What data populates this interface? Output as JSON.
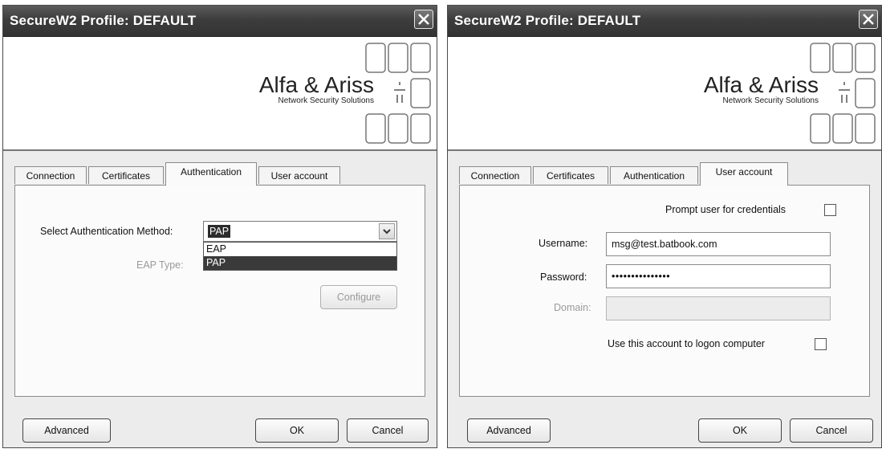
{
  "left_dialog": {
    "title": "SecureW2 Profile: DEFAULT",
    "logo": {
      "company": "Alfa & Ariss",
      "tagline": "Network Security Solutions"
    },
    "tabs": [
      {
        "label": "Connection"
      },
      {
        "label": "Certificates"
      },
      {
        "label": "Authentication"
      },
      {
        "label": "User account"
      }
    ],
    "active_tab": "Authentication",
    "auth_method_label": "Select Authentication Method:",
    "auth_method_value": "PAP",
    "auth_method_options": [
      "EAP",
      "PAP"
    ],
    "highlighted_option": "PAP",
    "eap_type_label": "EAP Type:",
    "configure_label": "Configure",
    "advanced_label": "Advanced",
    "ok_label": "OK",
    "cancel_label": "Cancel"
  },
  "right_dialog": {
    "title": "SecureW2 Profile: DEFAULT",
    "logo": {
      "company": "Alfa & Ariss",
      "tagline": "Network Security Solutions"
    },
    "tabs": [
      {
        "label": "Connection"
      },
      {
        "label": "Certificates"
      },
      {
        "label": "Authentication"
      },
      {
        "label": "User account"
      }
    ],
    "active_tab": "User account",
    "prompt_label": "Prompt user for credentials",
    "prompt_checked": false,
    "username_label": "Username:",
    "username_value": "msg@test.batbook.com",
    "password_label": "Password:",
    "password_value": "•••••••••••••••",
    "domain_label": "Domain:",
    "domain_value": "",
    "logon_label": "Use this account to logon computer",
    "logon_checked": false,
    "advanced_label": "Advanced",
    "ok_label": "OK",
    "cancel_label": "Cancel"
  },
  "icons": [
    "close-icon",
    "dropdown-arrow-icon",
    "logo-mark-icon"
  ]
}
